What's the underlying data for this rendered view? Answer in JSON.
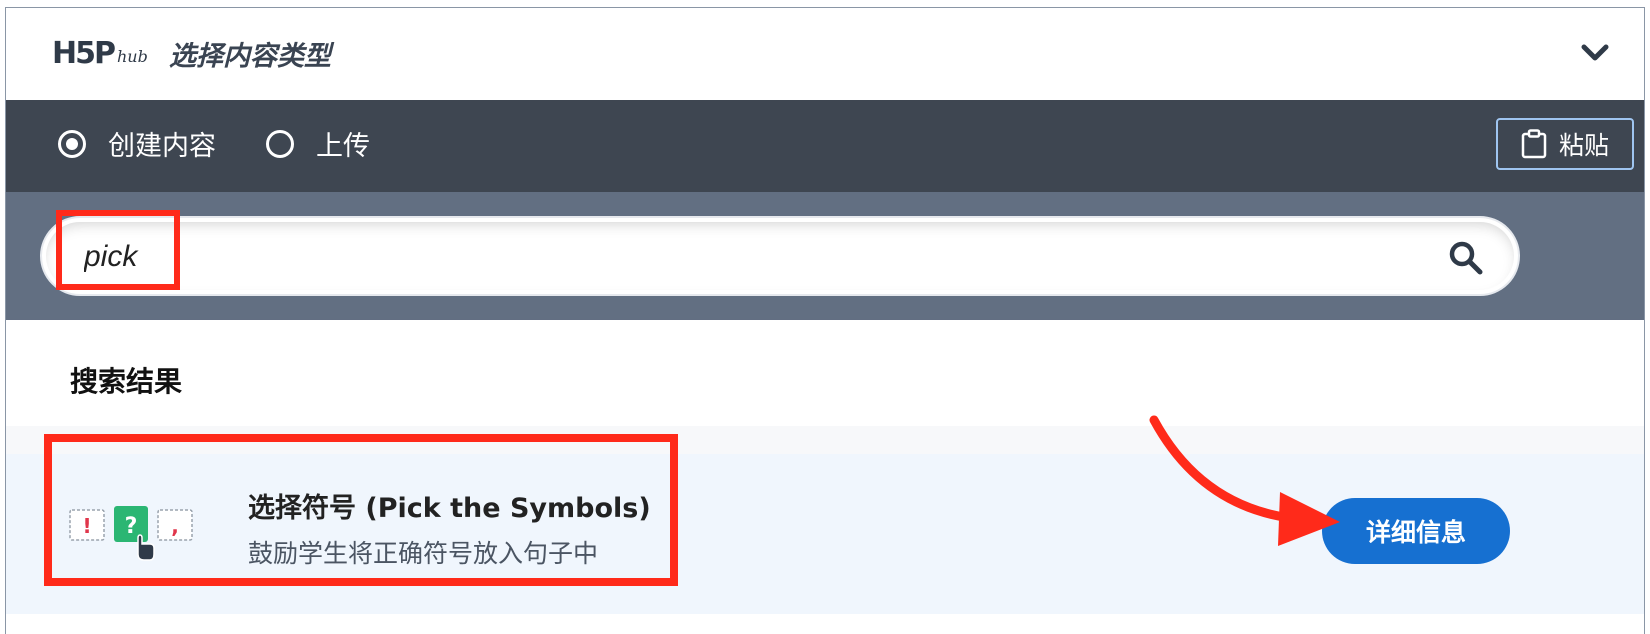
{
  "header": {
    "logo_main": "H5P",
    "logo_hub": "hub",
    "title": "选择内容类型"
  },
  "toolbar": {
    "options": [
      {
        "label": "创建内容",
        "checked": true
      },
      {
        "label": "上传",
        "checked": false
      }
    ],
    "paste_label": "粘贴"
  },
  "search": {
    "value": "pick"
  },
  "results": {
    "title": "搜索结果",
    "items": [
      {
        "title": "选择符号 (Pick the Symbols)",
        "description": "鼓励学生将正确符号放入句子中",
        "details_label": "详细信息"
      }
    ]
  },
  "colors": {
    "toolbar_bg": "#3e4651",
    "search_bg": "#626f82",
    "accent_blue": "#1670d1",
    "highlight_red": "#ff2a1a"
  }
}
